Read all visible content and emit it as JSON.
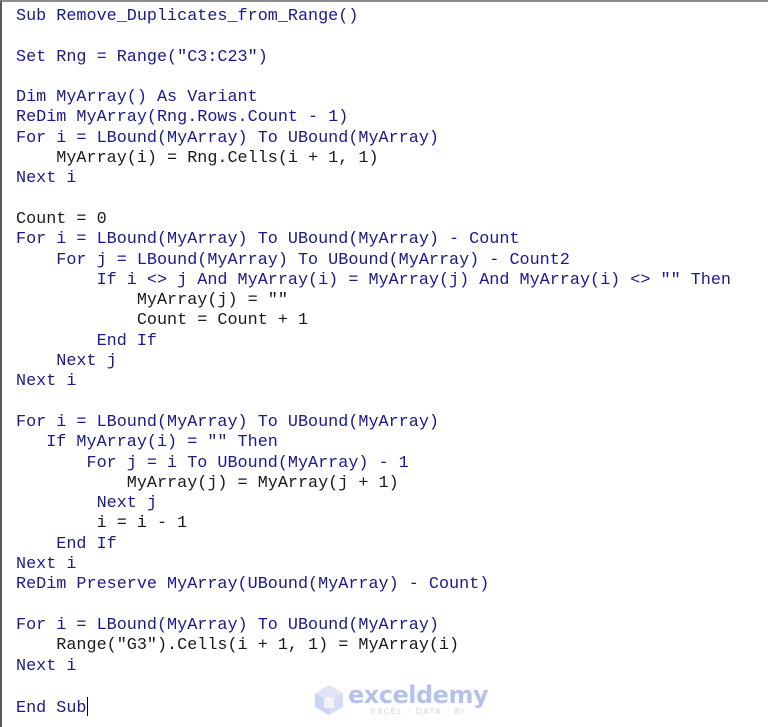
{
  "colors": {
    "keyword": "#1a1a8c",
    "text": "#1a1a1a",
    "background": "#ffffff"
  },
  "code_lines": [
    {
      "text": "Sub Remove_Duplicates_from_Range()",
      "style": "kw"
    },
    {
      "text": "",
      "style": "plain"
    },
    {
      "text": "Set Rng = Range(\"C3:C23\")",
      "style": "kw"
    },
    {
      "text": "",
      "style": "plain"
    },
    {
      "text": "Dim MyArray() As Variant",
      "style": "kw"
    },
    {
      "text": "ReDim MyArray(Rng.Rows.Count - 1)",
      "style": "kw"
    },
    {
      "text": "For i = LBound(MyArray) To UBound(MyArray)",
      "style": "kw"
    },
    {
      "text": "    MyArray(i) = Rng.Cells(i + 1, 1)",
      "style": "plain"
    },
    {
      "text": "Next i",
      "style": "kw"
    },
    {
      "text": "",
      "style": "plain"
    },
    {
      "text": "Count = 0",
      "style": "plain"
    },
    {
      "text": "For i = LBound(MyArray) To UBound(MyArray) - Count",
      "style": "kw"
    },
    {
      "text": "    For j = LBound(MyArray) To UBound(MyArray) - Count2",
      "style": "kw"
    },
    {
      "text": "        If i <> j And MyArray(i) = MyArray(j) And MyArray(i) <> \"\" Then",
      "style": "kw"
    },
    {
      "text": "            MyArray(j) = \"\"",
      "style": "plain"
    },
    {
      "text": "            Count = Count + 1",
      "style": "plain"
    },
    {
      "text": "        End If",
      "style": "kw"
    },
    {
      "text": "    Next j",
      "style": "kw"
    },
    {
      "text": "Next i",
      "style": "kw"
    },
    {
      "text": "",
      "style": "plain"
    },
    {
      "text": "For i = LBound(MyArray) To UBound(MyArray)",
      "style": "kw"
    },
    {
      "text": "   If MyArray(i) = \"\" Then",
      "style": "kw"
    },
    {
      "text": "       For j = i To UBound(MyArray) - 1",
      "style": "kw"
    },
    {
      "text": "           MyArray(j) = MyArray(j + 1)",
      "style": "plain"
    },
    {
      "text": "        Next j",
      "style": "kw"
    },
    {
      "text": "        i = i - 1",
      "style": "plain"
    },
    {
      "text": "    End If",
      "style": "kw"
    },
    {
      "text": "Next i",
      "style": "kw"
    },
    {
      "text": "ReDim Preserve MyArray(UBound(MyArray) - Count)",
      "style": "kw"
    },
    {
      "text": "",
      "style": "plain"
    },
    {
      "text": "For i = LBound(MyArray) To UBound(MyArray)",
      "style": "kw"
    },
    {
      "text": "    Range(\"G3\").Cells(i + 1, 1) = MyArray(i)",
      "style": "plain"
    },
    {
      "text": "Next i",
      "style": "kw"
    },
    {
      "text": "",
      "style": "plain"
    },
    {
      "text": "End Sub",
      "style": "kw",
      "cursor": true
    }
  ],
  "watermark": {
    "icon": "exceldemy-cube-logo-icon",
    "name": "exceldemy",
    "tagline": "EXCEL - DATA - BI"
  }
}
